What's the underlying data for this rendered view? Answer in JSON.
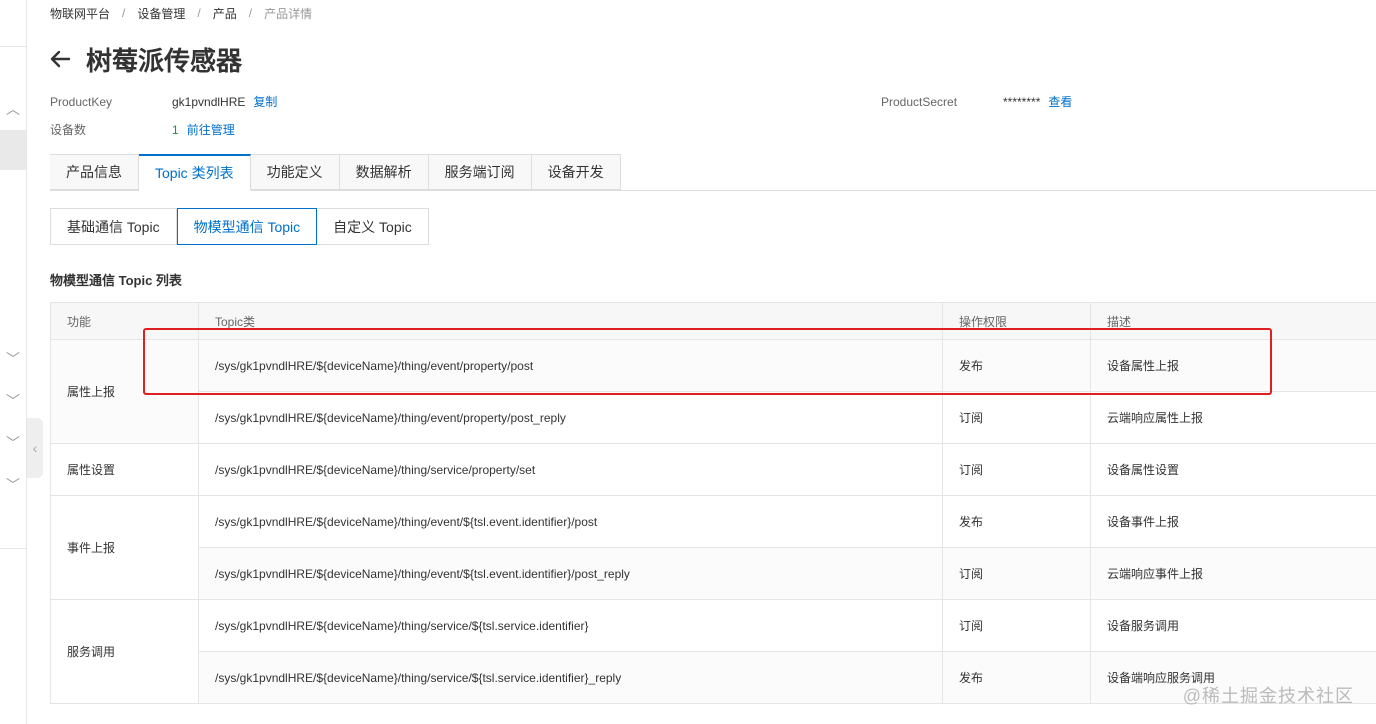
{
  "breadcrumb": {
    "items": [
      "物联网平台",
      "设备管理",
      "产品"
    ],
    "current": "产品详情",
    "separator": "/"
  },
  "header": {
    "title": "树莓派传感器"
  },
  "meta": {
    "product_key_label": "ProductKey",
    "product_key_value": "gk1pvndlHRE",
    "copy_label": "复制",
    "device_count_label": "设备数",
    "device_count_value": "1",
    "manage_label": "前往管理",
    "product_secret_label": "ProductSecret",
    "product_secret_value": "********",
    "view_label": "查看"
  },
  "main_tabs": [
    {
      "label": "产品信息"
    },
    {
      "label": "Topic 类列表"
    },
    {
      "label": "功能定义"
    },
    {
      "label": "数据解析"
    },
    {
      "label": "服务端订阅"
    },
    {
      "label": "设备开发"
    }
  ],
  "sub_tabs": [
    {
      "label": "基础通信 Topic"
    },
    {
      "label": "物模型通信 Topic"
    },
    {
      "label": "自定义 Topic"
    }
  ],
  "section_title": "物模型通信 Topic 列表",
  "table": {
    "headers": [
      "功能",
      "Topic类",
      "操作权限",
      "描述"
    ],
    "groups": [
      {
        "function": "属性上报",
        "rows": [
          {
            "topic": "/sys/gk1pvndlHRE/${deviceName}/thing/event/property/post",
            "permission": "发布",
            "description": "设备属性上报"
          },
          {
            "topic": "/sys/gk1pvndlHRE/${deviceName}/thing/event/property/post_reply",
            "permission": "订阅",
            "description": "云端响应属性上报"
          }
        ]
      },
      {
        "function": "属性设置",
        "rows": [
          {
            "topic": "/sys/gk1pvndlHRE/${deviceName}/thing/service/property/set",
            "permission": "订阅",
            "description": "设备属性设置"
          }
        ]
      },
      {
        "function": "事件上报",
        "rows": [
          {
            "topic": "/sys/gk1pvndlHRE/${deviceName}/thing/event/${tsl.event.identifier}/post",
            "permission": "发布",
            "description": "设备事件上报"
          },
          {
            "topic": "/sys/gk1pvndlHRE/${deviceName}/thing/event/${tsl.event.identifier}/post_reply",
            "permission": "订阅",
            "description": "云端响应事件上报"
          }
        ]
      },
      {
        "function": "服务调用",
        "rows": [
          {
            "topic": "/sys/gk1pvndlHRE/${deviceName}/thing/service/${tsl.service.identifier}",
            "permission": "订阅",
            "description": "设备服务调用"
          },
          {
            "topic": "/sys/gk1pvndlHRE/${deviceName}/thing/service/${tsl.service.identifier}_reply",
            "permission": "发布",
            "description": "设备端响应服务调用"
          }
        ]
      }
    ]
  },
  "watermark": "@稀土掘金技术社区",
  "colors": {
    "accent": "#0070cc",
    "highlight": "#e02020",
    "border": "#e5e5e5"
  }
}
